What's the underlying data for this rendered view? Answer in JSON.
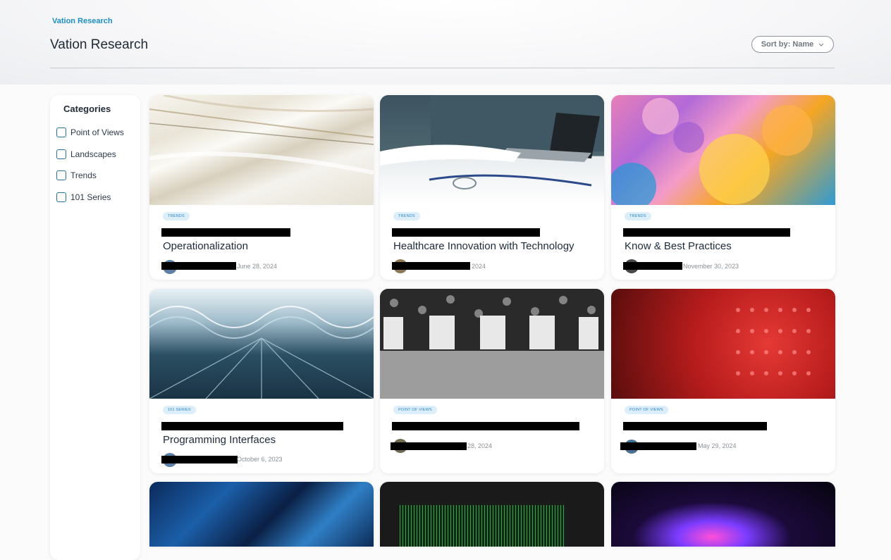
{
  "breadcrumb": "Vation Research",
  "page_title": "Vation Research",
  "sort": {
    "label": "Sort by: Name",
    "icon": "chevron-down-icon"
  },
  "categories": {
    "title": "Categories",
    "items": [
      {
        "label": "Point of Views",
        "checked": false
      },
      {
        "label": "Landscapes",
        "checked": false
      },
      {
        "label": "Trends",
        "checked": false
      },
      {
        "label": "101 Series",
        "checked": false
      }
    ]
  },
  "cards": [
    {
      "tag": "TRENDS",
      "title_visible": "Operationalization",
      "date": "June 28, 2024"
    },
    {
      "tag": "TRENDS",
      "title_visible": "Healthcare Innovation with Technology",
      "date": "2024"
    },
    {
      "tag": "TRENDS",
      "title_visible": "Know & Best Practices",
      "date": "November 30, 2023"
    },
    {
      "tag": "101 SERIES",
      "title_visible": "Programming Interfaces",
      "date": "October 6, 2023"
    },
    {
      "tag": "POINT OF VIEWS",
      "title_visible": "",
      "date": "28, 2024"
    },
    {
      "tag": "POINT OF VIEWS",
      "title_visible": "",
      "date": "May 29, 2024"
    }
  ],
  "colors": {
    "accent": "#1a8fc5",
    "tag_bg": "#dbeefa",
    "tag_text": "#2f86c4",
    "checkbox": "#2a6f97"
  }
}
